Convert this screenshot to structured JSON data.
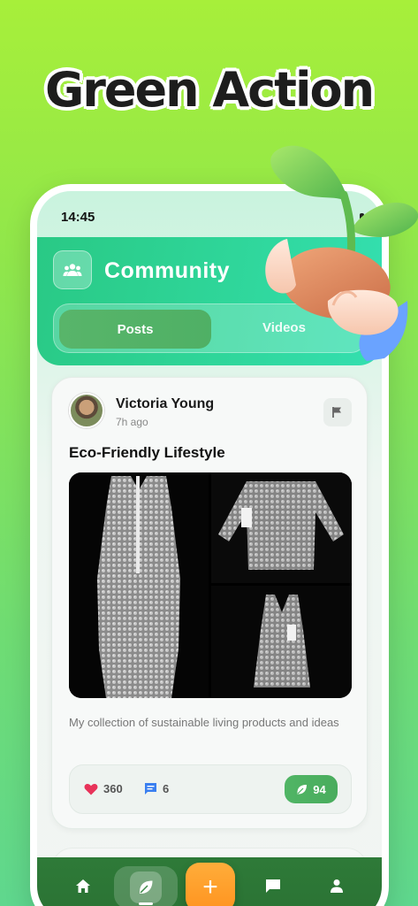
{
  "headline": "Green Action",
  "status_bar": {
    "time": "14:45"
  },
  "header": {
    "title": "Community"
  },
  "tabs": [
    {
      "label": "Posts",
      "active": true
    },
    {
      "label": "Videos",
      "active": false
    }
  ],
  "post": {
    "author": "Victoria Young",
    "time": "7h ago",
    "title": "Eco-Friendly Lifestyle",
    "description": "My collection of sustainable living products and ideas",
    "likes": "360",
    "comments": "6",
    "eco_points": "94"
  },
  "bottom_nav": {
    "items": [
      "home-icon",
      "leaf-icon",
      "plus-icon",
      "chat-icon",
      "person-icon"
    ],
    "add_symbol": "+"
  },
  "colors": {
    "accent_green": "#2fd69a",
    "nav_green": "#2e7a38",
    "add_orange": "#ff9f2e",
    "heart": "#e8335a",
    "comment_blue": "#3a7ff0"
  }
}
